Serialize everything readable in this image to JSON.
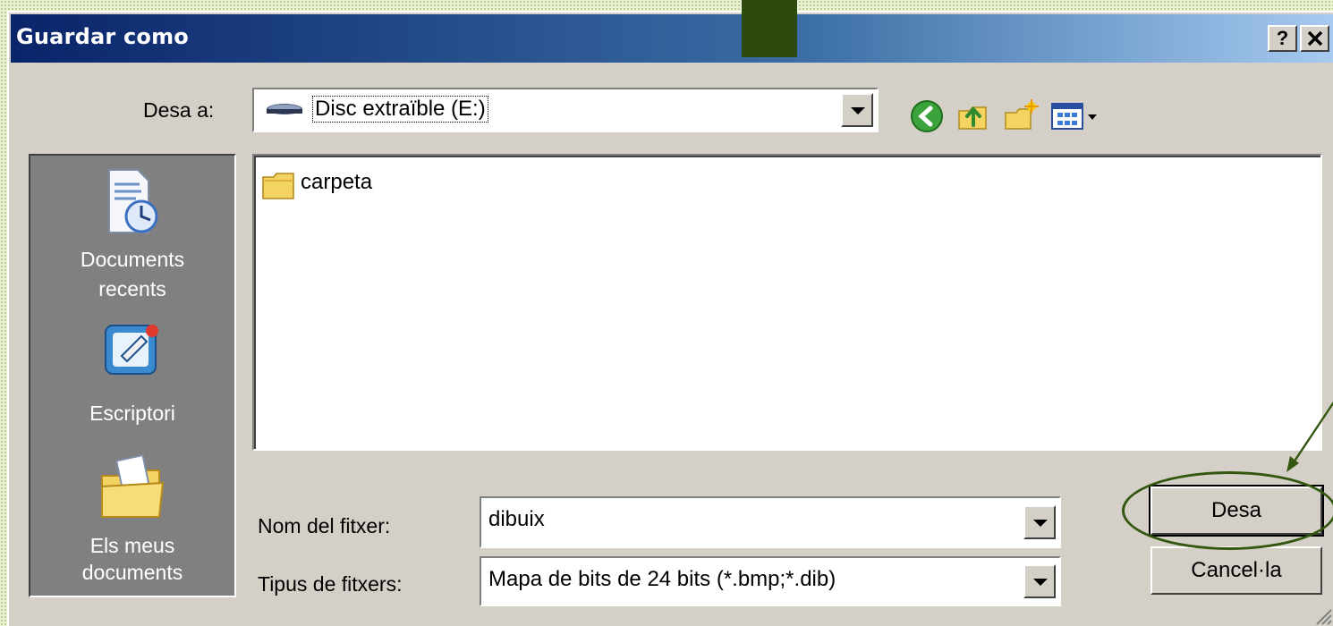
{
  "window": {
    "title": "Guardar como",
    "help_label": "?",
    "close_label": "✕"
  },
  "save_in": {
    "label": "Desa a:",
    "value": "Disc extraïble (E:)",
    "icon": "removable-drive-icon"
  },
  "toolbar": {
    "icons": [
      "back-icon",
      "up-folder-icon",
      "new-folder-icon",
      "view-menu-icon"
    ]
  },
  "places": [
    {
      "label_line1": "Documents",
      "label_line2": "recents",
      "icon": "recent-documents-icon"
    },
    {
      "label_line1": "Escriptori",
      "label_line2": "",
      "icon": "desktop-icon"
    },
    {
      "label_line1": "Els meus",
      "label_line2": "documents",
      "icon": "my-documents-icon"
    }
  ],
  "files": [
    {
      "name": "carpeta",
      "icon": "folder-icon"
    }
  ],
  "filename": {
    "label": "Nom del fitxer:",
    "value": "dibuix"
  },
  "filetype": {
    "label": "Tipus de fitxers:",
    "value": "Mapa de bits de 24 bits (*.bmp;*.dib)"
  },
  "buttons": {
    "save": "Desa",
    "cancel": "Cancel·la"
  },
  "colors": {
    "title_start": "#0a246a",
    "title_end": "#a6caf0",
    "dialog_bg": "#d4d0c8",
    "annotation": "#33570f"
  }
}
